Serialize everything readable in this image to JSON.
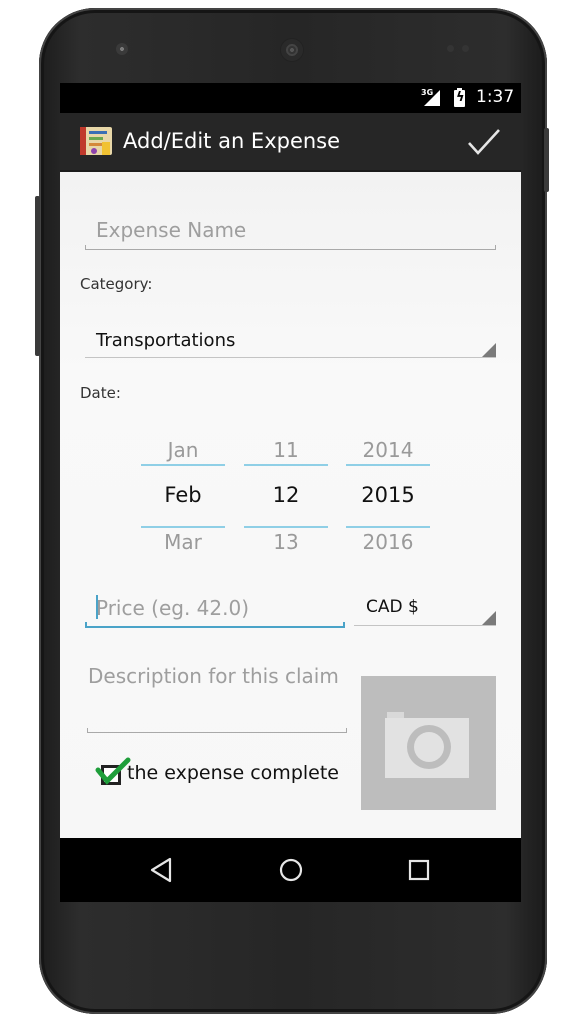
{
  "status_bar": {
    "network": "3G",
    "time": "1:37"
  },
  "action_bar": {
    "title": "Add/Edit an Expense",
    "app_icon": "app-notebook-icon",
    "confirm_icon": "checkmark-icon"
  },
  "form": {
    "expense_name_placeholder": "Expense Name",
    "category_label": "Category:",
    "category_value": "Transportations",
    "date_label": "Date:",
    "date_picker": {
      "month": {
        "prev": "Jan",
        "current": "Feb",
        "next": "Mar"
      },
      "day": {
        "prev": "11",
        "current": "12",
        "next": "13"
      },
      "year": {
        "prev": "2014",
        "current": "2015",
        "next": "2016"
      }
    },
    "price_placeholder": "Price (eg. 42.0)",
    "currency_value": "CAD $",
    "description_placeholder": "Description for this claim",
    "photo_icon": "camera-icon",
    "complete_checkbox_label": "the expense complete",
    "complete_checked": true
  },
  "nav_bar": {
    "back_icon": "back-triangle-icon",
    "home_icon": "home-circle-icon",
    "recents_icon": "recents-square-icon"
  },
  "colors": {
    "accent": "#4aa3c8",
    "picker_divider": "#8fcfe6",
    "check_green": "#1e9e3a",
    "action_bar": "#262626"
  }
}
